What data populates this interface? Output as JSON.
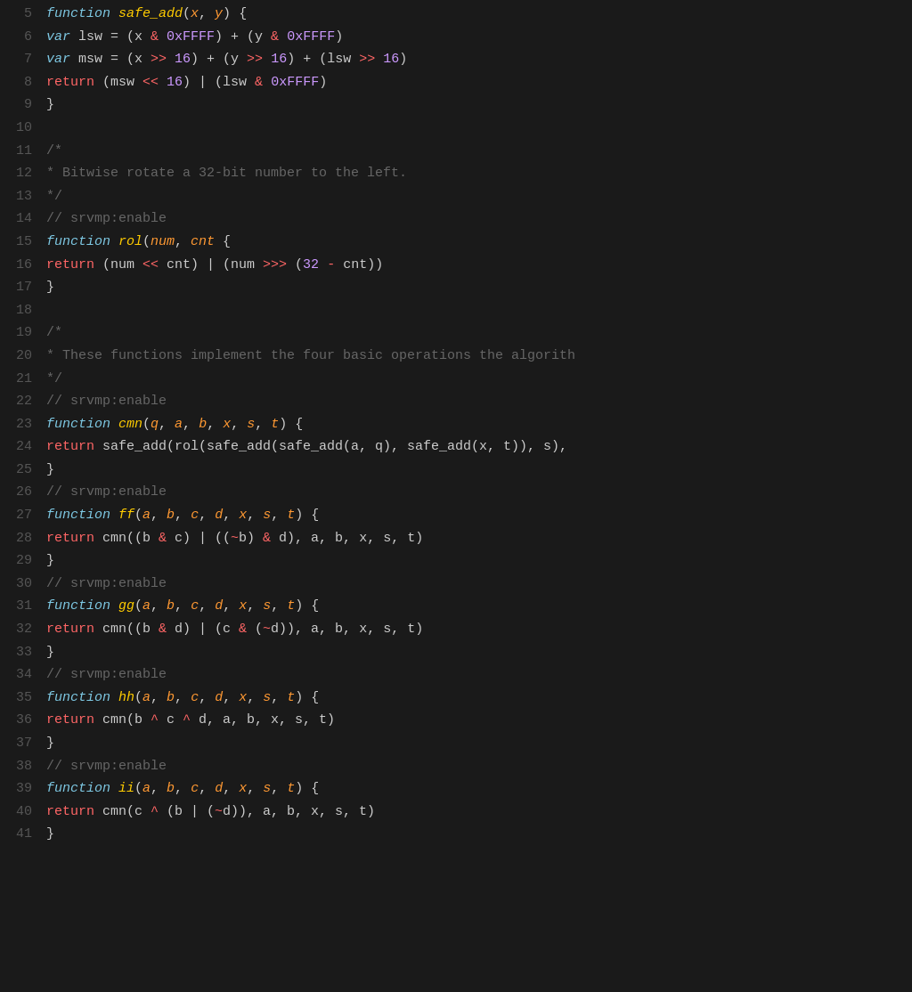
{
  "lines": [
    {
      "num": 5,
      "tokens": [
        {
          "t": "kw",
          "v": "function"
        },
        {
          "t": "plain",
          "v": " "
        },
        {
          "t": "fn",
          "v": "safe_add"
        },
        {
          "t": "plain",
          "v": "("
        },
        {
          "t": "param",
          "v": "x"
        },
        {
          "t": "plain",
          "v": ", "
        },
        {
          "t": "param",
          "v": "y"
        },
        {
          "t": "plain",
          "v": ")"
        },
        {
          "t": "plain",
          "v": " {"
        }
      ]
    },
    {
      "num": 6,
      "tokens": [
        {
          "t": "plain",
          "v": "    "
        },
        {
          "t": "kw",
          "v": "var"
        },
        {
          "t": "plain",
          "v": " lsw = (x "
        },
        {
          "t": "op",
          "v": "&"
        },
        {
          "t": "plain",
          "v": " "
        },
        {
          "t": "hex",
          "v": "0xFFFF"
        },
        {
          "t": "plain",
          "v": ")"
        },
        {
          "t": "plain",
          "v": " + (y "
        },
        {
          "t": "op",
          "v": "&"
        },
        {
          "t": "plain",
          "v": " "
        },
        {
          "t": "hex",
          "v": "0xFFFF"
        },
        {
          "t": "plain",
          "v": ")"
        }
      ]
    },
    {
      "num": 7,
      "tokens": [
        {
          "t": "plain",
          "v": "    "
        },
        {
          "t": "kw",
          "v": "var"
        },
        {
          "t": "plain",
          "v": " msw = (x "
        },
        {
          "t": "op",
          "v": ">>"
        },
        {
          "t": "plain",
          "v": " "
        },
        {
          "t": "num",
          "v": "16"
        },
        {
          "t": "plain",
          "v": ")"
        },
        {
          "t": "plain",
          "v": " + (y "
        },
        {
          "t": "op",
          "v": ">>"
        },
        {
          "t": "plain",
          "v": " "
        },
        {
          "t": "num",
          "v": "16"
        },
        {
          "t": "plain",
          "v": ")"
        },
        {
          "t": "plain",
          "v": " + (lsw "
        },
        {
          "t": "op",
          "v": ">>"
        },
        {
          "t": "plain",
          "v": " "
        },
        {
          "t": "num",
          "v": "16"
        },
        {
          "t": "plain",
          "v": ")"
        }
      ]
    },
    {
      "num": 8,
      "tokens": [
        {
          "t": "plain",
          "v": "    "
        },
        {
          "t": "op",
          "v": "return"
        },
        {
          "t": "plain",
          "v": " (msw "
        },
        {
          "t": "op",
          "v": "<<"
        },
        {
          "t": "plain",
          "v": " "
        },
        {
          "t": "num",
          "v": "16"
        },
        {
          "t": "plain",
          "v": ")"
        },
        {
          "t": "plain",
          "v": " | (lsw "
        },
        {
          "t": "op",
          "v": "&"
        },
        {
          "t": "plain",
          "v": " "
        },
        {
          "t": "hex",
          "v": "0xFFFF"
        },
        {
          "t": "plain",
          "v": ")"
        }
      ]
    },
    {
      "num": 9,
      "tokens": [
        {
          "t": "plain",
          "v": "  }"
        }
      ]
    },
    {
      "num": 10,
      "tokens": []
    },
    {
      "num": 11,
      "tokens": [
        {
          "t": "plain",
          "v": "  "
        },
        {
          "t": "cmt",
          "v": "/*"
        }
      ]
    },
    {
      "num": 12,
      "tokens": [
        {
          "t": "plain",
          "v": "   "
        },
        {
          "t": "cmt",
          "v": "* Bitwise rotate a 32-bit number to the left."
        }
      ]
    },
    {
      "num": 13,
      "tokens": [
        {
          "t": "plain",
          "v": "   "
        },
        {
          "t": "cmt",
          "v": "*/"
        }
      ]
    },
    {
      "num": 14,
      "tokens": [
        {
          "t": "plain",
          "v": "  "
        },
        {
          "t": "cmt",
          "v": "// srvmp:enable"
        }
      ]
    },
    {
      "num": 15,
      "tokens": [
        {
          "t": "plain",
          "v": "  "
        },
        {
          "t": "kw",
          "v": "function"
        },
        {
          "t": "plain",
          "v": " "
        },
        {
          "t": "fn",
          "v": "rol"
        },
        {
          "t": "plain",
          "v": "("
        },
        {
          "t": "param",
          "v": "num"
        },
        {
          "t": "plain",
          "v": ", "
        },
        {
          "t": "param",
          "v": "cnt"
        },
        {
          "t": "plain",
          "v": " {"
        }
      ]
    },
    {
      "num": 16,
      "tokens": [
        {
          "t": "plain",
          "v": "    "
        },
        {
          "t": "op",
          "v": "return"
        },
        {
          "t": "plain",
          "v": " (num "
        },
        {
          "t": "op",
          "v": "<<"
        },
        {
          "t": "plain",
          "v": " cnt) | (num "
        },
        {
          "t": "op",
          "v": ">>>"
        },
        {
          "t": "plain",
          "v": " ("
        },
        {
          "t": "num",
          "v": "32"
        },
        {
          "t": "plain",
          "v": " "
        },
        {
          "t": "op",
          "v": "-"
        },
        {
          "t": "plain",
          "v": " cnt))"
        }
      ]
    },
    {
      "num": 17,
      "tokens": [
        {
          "t": "plain",
          "v": "  }"
        }
      ]
    },
    {
      "num": 18,
      "tokens": []
    },
    {
      "num": 19,
      "tokens": [
        {
          "t": "plain",
          "v": "  "
        },
        {
          "t": "cmt",
          "v": "/*"
        }
      ]
    },
    {
      "num": 20,
      "tokens": [
        {
          "t": "plain",
          "v": "   "
        },
        {
          "t": "cmt",
          "v": "* These functions implement the four basic operations the algorith"
        }
      ]
    },
    {
      "num": 21,
      "tokens": [
        {
          "t": "plain",
          "v": "   "
        },
        {
          "t": "cmt",
          "v": "*/"
        }
      ]
    },
    {
      "num": 22,
      "tokens": [
        {
          "t": "plain",
          "v": "  "
        },
        {
          "t": "cmt",
          "v": "// srvmp:enable"
        }
      ]
    },
    {
      "num": 23,
      "tokens": [
        {
          "t": "plain",
          "v": "  "
        },
        {
          "t": "kw",
          "v": "function"
        },
        {
          "t": "plain",
          "v": " "
        },
        {
          "t": "fn",
          "v": "cmn"
        },
        {
          "t": "plain",
          "v": "("
        },
        {
          "t": "param",
          "v": "q"
        },
        {
          "t": "plain",
          "v": ", "
        },
        {
          "t": "param",
          "v": "a"
        },
        {
          "t": "plain",
          "v": ", "
        },
        {
          "t": "param",
          "v": "b"
        },
        {
          "t": "plain",
          "v": ", "
        },
        {
          "t": "param",
          "v": "x"
        },
        {
          "t": "plain",
          "v": ", "
        },
        {
          "t": "param",
          "v": "s"
        },
        {
          "t": "plain",
          "v": ", "
        },
        {
          "t": "param",
          "v": "t"
        },
        {
          "t": "plain",
          "v": ") {"
        }
      ]
    },
    {
      "num": 24,
      "tokens": [
        {
          "t": "plain",
          "v": "    "
        },
        {
          "t": "op",
          "v": "return"
        },
        {
          "t": "plain",
          "v": " safe_add(rol(safe_add(safe_add(a, q), safe_add(x, t)), s),"
        }
      ]
    },
    {
      "num": 25,
      "tokens": [
        {
          "t": "plain",
          "v": "  }"
        }
      ]
    },
    {
      "num": 26,
      "tokens": [
        {
          "t": "plain",
          "v": "  "
        },
        {
          "t": "cmt",
          "v": "// srvmp:enable"
        }
      ]
    },
    {
      "num": 27,
      "tokens": [
        {
          "t": "plain",
          "v": "  "
        },
        {
          "t": "kw",
          "v": "function"
        },
        {
          "t": "plain",
          "v": " "
        },
        {
          "t": "fn",
          "v": "ff"
        },
        {
          "t": "plain",
          "v": "("
        },
        {
          "t": "param",
          "v": "a"
        },
        {
          "t": "plain",
          "v": ", "
        },
        {
          "t": "param",
          "v": "b"
        },
        {
          "t": "plain",
          "v": ", "
        },
        {
          "t": "param",
          "v": "c"
        },
        {
          "t": "plain",
          "v": ", "
        },
        {
          "t": "param",
          "v": "d"
        },
        {
          "t": "plain",
          "v": ", "
        },
        {
          "t": "param",
          "v": "x"
        },
        {
          "t": "plain",
          "v": ", "
        },
        {
          "t": "param",
          "v": "s"
        },
        {
          "t": "plain",
          "v": ", "
        },
        {
          "t": "param",
          "v": "t"
        },
        {
          "t": "plain",
          "v": ") {"
        }
      ]
    },
    {
      "num": 28,
      "tokens": [
        {
          "t": "plain",
          "v": "    "
        },
        {
          "t": "op",
          "v": "return"
        },
        {
          "t": "plain",
          "v": " cmn((b "
        },
        {
          "t": "op",
          "v": "&"
        },
        {
          "t": "plain",
          "v": " c) | (("
        },
        {
          "t": "op",
          "v": "~"
        },
        {
          "t": "plain",
          "v": "b) "
        },
        {
          "t": "op",
          "v": "&"
        },
        {
          "t": "plain",
          "v": " d), a, b, x, s, t)"
        }
      ]
    },
    {
      "num": 29,
      "tokens": [
        {
          "t": "plain",
          "v": "  }"
        }
      ]
    },
    {
      "num": 30,
      "tokens": [
        {
          "t": "plain",
          "v": "  "
        },
        {
          "t": "cmt",
          "v": "// srvmp:enable"
        }
      ]
    },
    {
      "num": 31,
      "tokens": [
        {
          "t": "plain",
          "v": "  "
        },
        {
          "t": "kw",
          "v": "function"
        },
        {
          "t": "plain",
          "v": " "
        },
        {
          "t": "fn",
          "v": "gg"
        },
        {
          "t": "plain",
          "v": "("
        },
        {
          "t": "param",
          "v": "a"
        },
        {
          "t": "plain",
          "v": ", "
        },
        {
          "t": "param",
          "v": "b"
        },
        {
          "t": "plain",
          "v": ", "
        },
        {
          "t": "param",
          "v": "c"
        },
        {
          "t": "plain",
          "v": ", "
        },
        {
          "t": "param",
          "v": "d"
        },
        {
          "t": "plain",
          "v": ", "
        },
        {
          "t": "param",
          "v": "x"
        },
        {
          "t": "plain",
          "v": ", "
        },
        {
          "t": "param",
          "v": "s"
        },
        {
          "t": "plain",
          "v": ", "
        },
        {
          "t": "param",
          "v": "t"
        },
        {
          "t": "plain",
          "v": ") {"
        }
      ]
    },
    {
      "num": 32,
      "tokens": [
        {
          "t": "plain",
          "v": "    "
        },
        {
          "t": "op",
          "v": "return"
        },
        {
          "t": "plain",
          "v": " cmn((b "
        },
        {
          "t": "op",
          "v": "&"
        },
        {
          "t": "plain",
          "v": " d) | (c "
        },
        {
          "t": "op",
          "v": "&"
        },
        {
          "t": "plain",
          "v": " ("
        },
        {
          "t": "op",
          "v": "~"
        },
        {
          "t": "plain",
          "v": "d)), a, b, x, s, t)"
        }
      ]
    },
    {
      "num": 33,
      "tokens": [
        {
          "t": "plain",
          "v": "  }"
        }
      ]
    },
    {
      "num": 34,
      "tokens": [
        {
          "t": "plain",
          "v": "  "
        },
        {
          "t": "cmt",
          "v": "// srvmp:enable"
        }
      ]
    },
    {
      "num": 35,
      "tokens": [
        {
          "t": "plain",
          "v": "  "
        },
        {
          "t": "kw",
          "v": "function"
        },
        {
          "t": "plain",
          "v": " "
        },
        {
          "t": "fn",
          "v": "hh"
        },
        {
          "t": "plain",
          "v": "("
        },
        {
          "t": "param",
          "v": "a"
        },
        {
          "t": "plain",
          "v": ", "
        },
        {
          "t": "param",
          "v": "b"
        },
        {
          "t": "plain",
          "v": ", "
        },
        {
          "t": "param",
          "v": "c"
        },
        {
          "t": "plain",
          "v": ", "
        },
        {
          "t": "param",
          "v": "d"
        },
        {
          "t": "plain",
          "v": ", "
        },
        {
          "t": "param",
          "v": "x"
        },
        {
          "t": "plain",
          "v": ", "
        },
        {
          "t": "param",
          "v": "s"
        },
        {
          "t": "plain",
          "v": ", "
        },
        {
          "t": "param",
          "v": "t"
        },
        {
          "t": "plain",
          "v": ") {"
        }
      ]
    },
    {
      "num": 36,
      "tokens": [
        {
          "t": "plain",
          "v": "    "
        },
        {
          "t": "op",
          "v": "return"
        },
        {
          "t": "plain",
          "v": " cmn(b "
        },
        {
          "t": "op",
          "v": "^"
        },
        {
          "t": "plain",
          "v": " c "
        },
        {
          "t": "op",
          "v": "^"
        },
        {
          "t": "plain",
          "v": " d, a, b, x, s, t)"
        }
      ]
    },
    {
      "num": 37,
      "tokens": [
        {
          "t": "plain",
          "v": "  }"
        }
      ]
    },
    {
      "num": 38,
      "tokens": [
        {
          "t": "plain",
          "v": "  "
        },
        {
          "t": "cmt",
          "v": "// srvmp:enable"
        }
      ]
    },
    {
      "num": 39,
      "tokens": [
        {
          "t": "plain",
          "v": "  "
        },
        {
          "t": "kw",
          "v": "function"
        },
        {
          "t": "plain",
          "v": " "
        },
        {
          "t": "fn",
          "v": "ii"
        },
        {
          "t": "plain",
          "v": "("
        },
        {
          "t": "param",
          "v": "a"
        },
        {
          "t": "plain",
          "v": ", "
        },
        {
          "t": "param",
          "v": "b"
        },
        {
          "t": "plain",
          "v": ", "
        },
        {
          "t": "param",
          "v": "c"
        },
        {
          "t": "plain",
          "v": ", "
        },
        {
          "t": "param",
          "v": "d"
        },
        {
          "t": "plain",
          "v": ", "
        },
        {
          "t": "param",
          "v": "x"
        },
        {
          "t": "plain",
          "v": ", "
        },
        {
          "t": "param",
          "v": "s"
        },
        {
          "t": "plain",
          "v": ", "
        },
        {
          "t": "param",
          "v": "t"
        },
        {
          "t": "plain",
          "v": ") {"
        }
      ]
    },
    {
      "num": 40,
      "tokens": [
        {
          "t": "plain",
          "v": "    "
        },
        {
          "t": "op",
          "v": "return"
        },
        {
          "t": "plain",
          "v": " cmn(c "
        },
        {
          "t": "op",
          "v": "^"
        },
        {
          "t": "plain",
          "v": " (b | ("
        },
        {
          "t": "op",
          "v": "~"
        },
        {
          "t": "plain",
          "v": "d)), a, b, x, s, t)"
        }
      ]
    },
    {
      "num": 41,
      "tokens": [
        {
          "t": "plain",
          "v": "  }"
        }
      ]
    }
  ]
}
